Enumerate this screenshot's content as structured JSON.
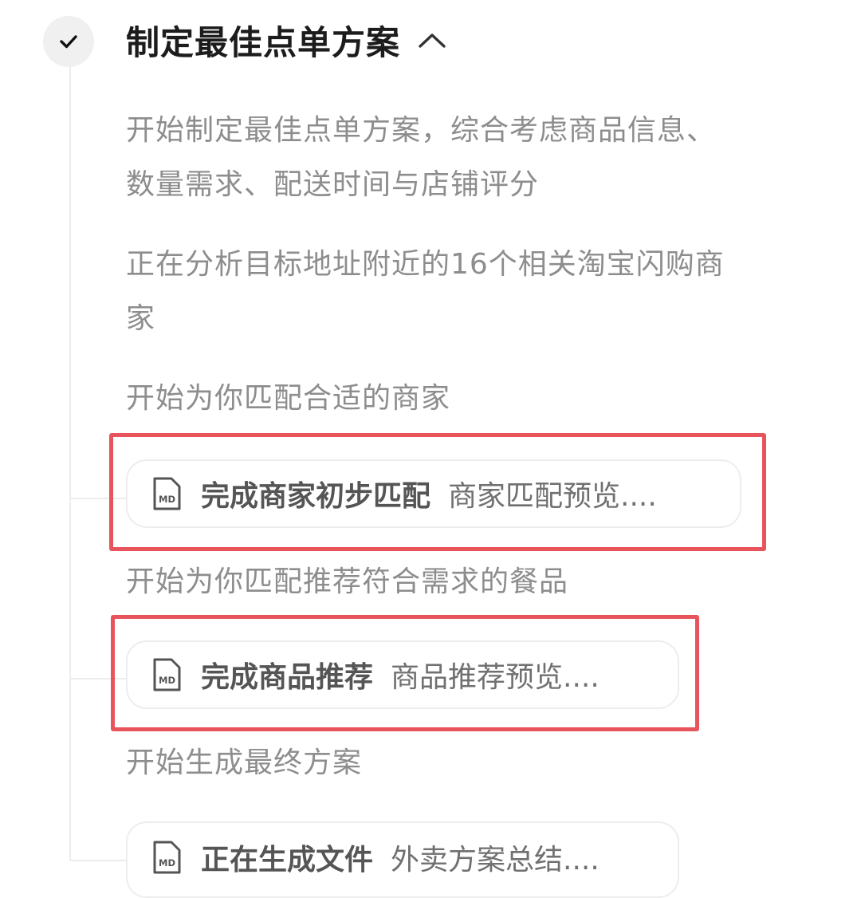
{
  "step": {
    "title": "制定最佳点单方案",
    "status_icon": "check-icon",
    "toggle_icon": "chevron-up-icon"
  },
  "paragraphs": [
    "开始制定最佳点单方案，综合考虑商品信息、数量需求、配送时间与店铺评分",
    "正在分析目标地址附近的16个相关淘宝闪购商家",
    "开始为你匹配合适的商家"
  ],
  "cards": [
    {
      "icon": "md-file-icon",
      "title": "完成商家初步匹配",
      "desc": "商家匹配预览...."
    },
    {
      "icon": "md-file-icon",
      "title": "完成商品推荐",
      "desc": "商品推荐预览...."
    },
    {
      "icon": "md-file-icon",
      "title": "正在生成文件",
      "desc": "外卖方案总结...."
    }
  ],
  "after_card_1": "开始为你匹配推荐符合需求的餐品",
  "after_card_2": "开始生成最终方案",
  "colors": {
    "highlight": "#e8545c",
    "timeline": "#ececec",
    "muted_text": "#8d8d8d"
  }
}
